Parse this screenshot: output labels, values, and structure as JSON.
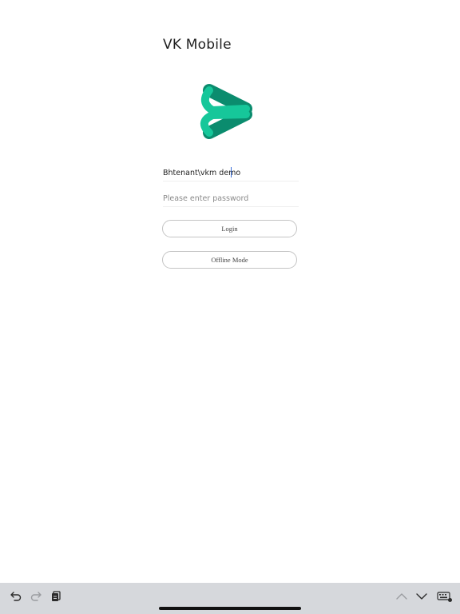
{
  "app": {
    "title": "VK Mobile"
  },
  "logo": {
    "icon": "vk-chevron-logo-icon",
    "colors": {
      "dark": "#0b8c6e",
      "light": "#16c79a"
    }
  },
  "login_form": {
    "username_value": "Bhtenant\\vkm demo",
    "password_placeholder": "Please enter password",
    "login_label": "Login",
    "offline_label": "Offline Mode"
  },
  "keyboard_toolbar": {
    "left_icons": [
      "undo-icon",
      "redo-icon",
      "clipboard-icon"
    ],
    "right_icons": [
      "chevron-up-icon",
      "chevron-down-icon",
      "keyboard-icon"
    ],
    "background_color": "#d6d8dc"
  }
}
